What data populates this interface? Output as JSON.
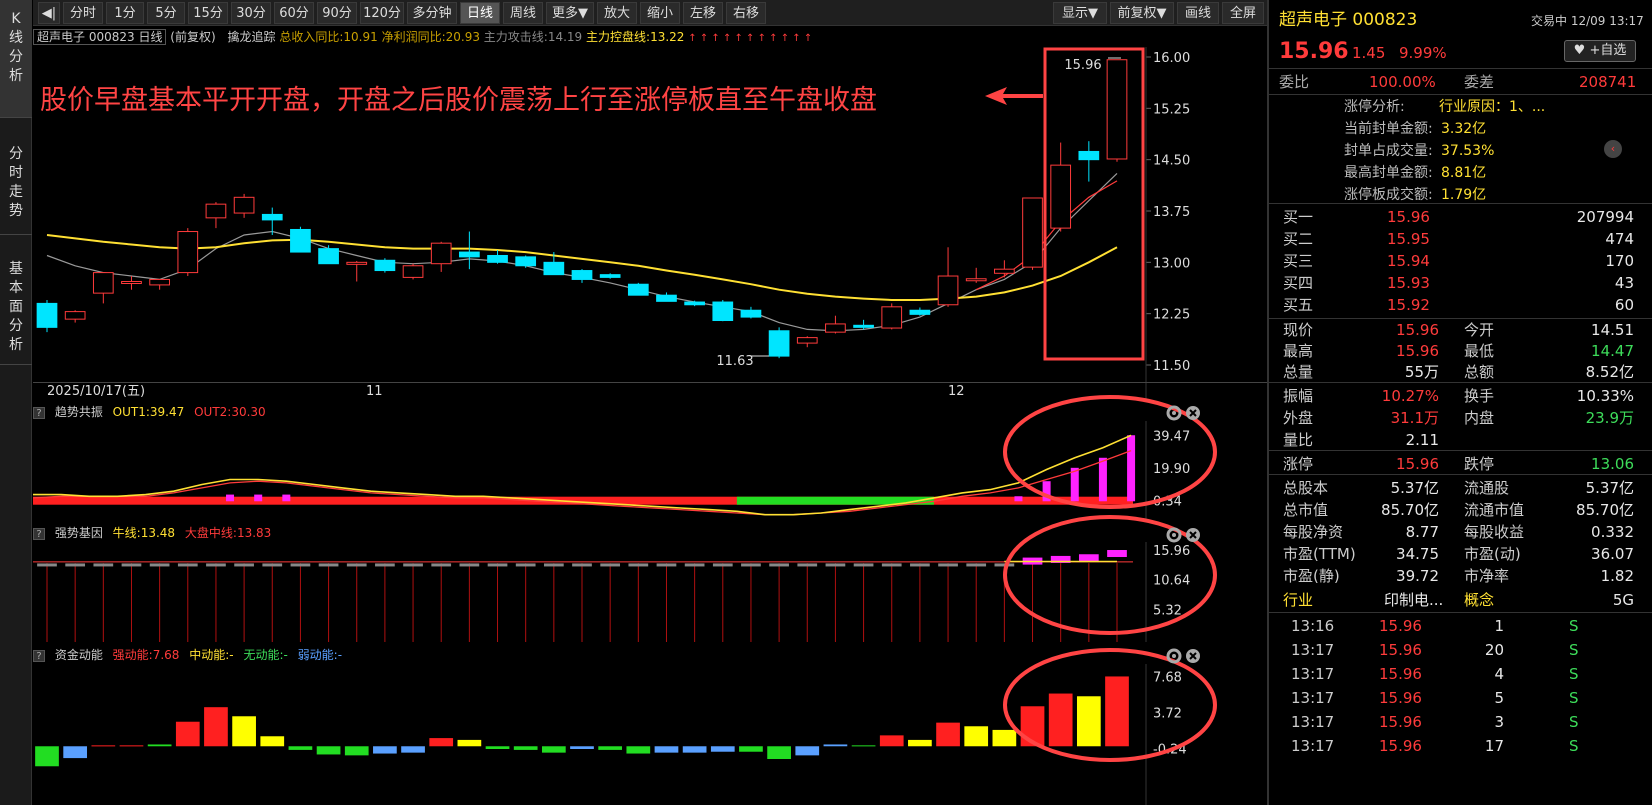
{
  "sidebar": {
    "tabs": [
      {
        "label": "K线分析",
        "chars": [
          "K",
          "线",
          "分",
          "析"
        ]
      },
      {
        "label": "分时走势",
        "chars": [
          "分",
          "时",
          "走",
          "势"
        ]
      },
      {
        "label": "基本面分析",
        "chars": [
          "基",
          "本",
          "面",
          "分",
          "析"
        ]
      }
    ]
  },
  "toolbar": {
    "back_label": "◀|",
    "periods": [
      "分时",
      "1分",
      "5分",
      "15分",
      "30分",
      "60分",
      "90分",
      "120分",
      "多分钟",
      "日线",
      "周线",
      "更多▼"
    ],
    "active_period": "日线",
    "tools": [
      "放大",
      "缩小",
      "左移",
      "右移"
    ],
    "right_tools": [
      "显示▼",
      "前复权▼",
      "画线",
      "全屏"
    ]
  },
  "titlebar": {
    "stock": "超声电子 000823 日线",
    "adj": "(前复权)",
    "indicator_name": "擒龙追踪",
    "income": "总收入同比:10.91",
    "profit": "净利润同比:20.93",
    "attack": "主力攻击线:14.19",
    "control": "主力控盘线:13.22",
    "marks": "↑ ↑ ↑ ↑ ↑ ↑ ↑ ↑ ↑ ↑ ↑"
  },
  "annotation": {
    "text": "股价早盘基本平开开盘，开盘之后股价震荡上行至涨停板直至午盘收盘",
    "color": "#ff4444"
  },
  "main_chart": {
    "y_ticks": [
      "16.00",
      "15.25",
      "14.50",
      "13.75",
      "13.00",
      "12.25",
      "11.50"
    ],
    "date_labels": [
      {
        "text": "2025/10/17(五)"
      },
      {
        "text": "11"
      },
      {
        "text": "12"
      }
    ],
    "high_label": "15.96",
    "low_label": "11.63",
    "colors": {
      "up": "#ff3b3b",
      "down": "#00e5ff",
      "ma_yellow": "#ffe033",
      "ma_gray": "#9a9a9a",
      "ma_red": "#ff3b3b",
      "highlight": "#ff4444"
    }
  },
  "chart_data": [
    {
      "type": "candlestick",
      "title": "超声电子 000823 日线",
      "ylim": [
        11.5,
        16.0
      ],
      "candles": [
        {
          "o": 12.4,
          "h": 12.45,
          "l": 11.98,
          "c": 12.05
        },
        {
          "o": 12.17,
          "h": 12.3,
          "l": 12.12,
          "c": 12.28
        },
        {
          "o": 12.55,
          "h": 12.85,
          "l": 12.4,
          "c": 12.85
        },
        {
          "o": 12.7,
          "h": 12.8,
          "l": 12.6,
          "c": 12.72
        },
        {
          "o": 12.67,
          "h": 12.75,
          "l": 12.6,
          "c": 12.75
        },
        {
          "o": 12.85,
          "h": 13.5,
          "l": 12.8,
          "c": 13.45
        },
        {
          "o": 13.65,
          "h": 13.88,
          "l": 13.5,
          "c": 13.85
        },
        {
          "o": 13.72,
          "h": 14.0,
          "l": 13.65,
          "c": 13.95
        },
        {
          "o": 13.7,
          "h": 13.8,
          "l": 13.4,
          "c": 13.62
        },
        {
          "o": 13.48,
          "h": 13.52,
          "l": 13.15,
          "c": 13.15
        },
        {
          "o": 13.2,
          "h": 13.25,
          "l": 12.98,
          "c": 12.98
        },
        {
          "o": 13.0,
          "h": 13.02,
          "l": 12.72,
          "c": 13.0
        },
        {
          "o": 13.03,
          "h": 13.06,
          "l": 12.85,
          "c": 12.88
        },
        {
          "o": 12.78,
          "h": 12.98,
          "l": 12.75,
          "c": 12.95
        },
        {
          "o": 12.98,
          "h": 13.3,
          "l": 12.86,
          "c": 13.28
        },
        {
          "o": 13.15,
          "h": 13.45,
          "l": 12.9,
          "c": 13.08
        },
        {
          "o": 13.1,
          "h": 13.18,
          "l": 12.98,
          "c": 13.0
        },
        {
          "o": 13.08,
          "h": 13.1,
          "l": 12.92,
          "c": 12.95
        },
        {
          "o": 13.0,
          "h": 13.15,
          "l": 12.82,
          "c": 12.82
        },
        {
          "o": 12.88,
          "h": 12.9,
          "l": 12.7,
          "c": 12.75
        },
        {
          "o": 12.82,
          "h": 12.84,
          "l": 12.76,
          "c": 12.78
        },
        {
          "o": 12.68,
          "h": 12.7,
          "l": 12.52,
          "c": 12.52
        },
        {
          "o": 12.52,
          "h": 12.56,
          "l": 12.43,
          "c": 12.43
        },
        {
          "o": 12.42,
          "h": 12.44,
          "l": 12.36,
          "c": 12.38
        },
        {
          "o": 12.42,
          "h": 12.45,
          "l": 12.14,
          "c": 12.15
        },
        {
          "o": 12.3,
          "h": 12.35,
          "l": 12.18,
          "c": 12.2
        },
        {
          "o": 12.0,
          "h": 12.05,
          "l": 11.6,
          "c": 11.63
        },
        {
          "o": 11.82,
          "h": 11.92,
          "l": 11.76,
          "c": 11.9
        },
        {
          "o": 11.98,
          "h": 12.22,
          "l": 11.96,
          "c": 12.1
        },
        {
          "o": 12.08,
          "h": 12.16,
          "l": 12.02,
          "c": 12.05
        },
        {
          "o": 12.04,
          "h": 12.4,
          "l": 12.02,
          "c": 12.35
        },
        {
          "o": 12.3,
          "h": 12.34,
          "l": 12.22,
          "c": 12.24
        },
        {
          "o": 12.38,
          "h": 13.22,
          "l": 12.35,
          "c": 12.8
        },
        {
          "o": 12.74,
          "h": 12.92,
          "l": 12.7,
          "c": 12.76
        },
        {
          "o": 12.84,
          "h": 13.03,
          "l": 12.78,
          "c": 12.9
        },
        {
          "o": 12.93,
          "h": 13.56,
          "l": 12.89,
          "c": 13.94
        },
        {
          "o": 13.5,
          "h": 14.75,
          "l": 13.45,
          "c": 14.42
        },
        {
          "o": 14.62,
          "h": 14.77,
          "l": 14.18,
          "c": 14.5
        },
        {
          "o": 14.51,
          "h": 15.96,
          "l": 14.47,
          "c": 15.96
        }
      ],
      "ma_yellow": [
        13.4,
        13.35,
        13.3,
        13.26,
        13.22,
        13.2,
        13.22,
        13.28,
        13.32,
        13.33,
        13.3,
        13.26,
        13.22,
        13.2,
        13.2,
        13.2,
        13.18,
        13.15,
        13.1,
        13.05,
        13.0,
        12.95,
        12.88,
        12.82,
        12.75,
        12.68,
        12.6,
        12.54,
        12.5,
        12.47,
        12.45,
        12.45,
        12.47,
        12.5,
        12.56,
        12.66,
        12.8,
        13.0,
        13.22
      ],
      "ma_gray": [
        13.1,
        12.95,
        12.85,
        12.8,
        12.75,
        12.9,
        13.2,
        13.4,
        13.45,
        13.35,
        13.2,
        13.1,
        13.0,
        12.98,
        13.0,
        13.05,
        13.02,
        12.95,
        12.85,
        12.78,
        12.7,
        12.6,
        12.5,
        12.42,
        12.35,
        12.28,
        12.12,
        12.02,
        12.0,
        12.02,
        12.08,
        12.2,
        12.4,
        12.6,
        12.75,
        13.0,
        13.5,
        13.9,
        14.3
      ],
      "ma_red": [
        null,
        null,
        null,
        null,
        null,
        null,
        null,
        null,
        null,
        null,
        null,
        null,
        null,
        null,
        null,
        null,
        null,
        null,
        null,
        null,
        null,
        null,
        null,
        null,
        null,
        null,
        null,
        null,
        null,
        null,
        null,
        null,
        null,
        12.6,
        12.8,
        13.1,
        13.6,
        13.95,
        14.19
      ]
    },
    {
      "type": "bar",
      "title": "趋势共振",
      "series_labels": {
        "out1": "OUT1:39.47",
        "out2": "OUT2:30.30"
      },
      "y_ticks": [
        "39.47",
        "19.90",
        "0.34"
      ],
      "ylim": [
        -10,
        45
      ],
      "out1": [
        4,
        4,
        3,
        3,
        4,
        6,
        10,
        13,
        13,
        12,
        10,
        8,
        6,
        5,
        4,
        3,
        3,
        2,
        1,
        0,
        -1,
        -2,
        -3,
        -4,
        -5,
        -6,
        -8,
        -8,
        -7,
        -5,
        -3,
        -1,
        2,
        5,
        7,
        11,
        19,
        26,
        32,
        39.47
      ],
      "out2": [
        2,
        3,
        3,
        3,
        3,
        5,
        8,
        11,
        12,
        11,
        9,
        7,
        5,
        4,
        3,
        2,
        2,
        1,
        0,
        -1,
        -2,
        -3,
        -4,
        -5,
        -6,
        -7,
        -8,
        -8,
        -7,
        -6,
        -4,
        -2,
        0,
        3,
        5,
        8,
        13,
        18,
        24,
        30.3
      ],
      "bars": [
        0,
        0,
        0,
        0,
        0,
        0,
        0,
        4,
        4,
        4,
        0,
        0,
        0,
        0,
        0,
        0,
        0,
        0,
        0,
        0,
        0,
        0,
        0,
        0,
        0,
        0,
        0,
        0,
        0,
        0,
        0,
        0,
        0,
        0,
        0,
        3,
        12,
        20,
        26,
        39.47
      ]
    },
    {
      "type": "bar",
      "title": "强势基因",
      "series_labels": {
        "bull": "牛线:13.48",
        "market": "大盘中线:13.83"
      },
      "y_ticks": [
        "15.96",
        "10.64",
        "5.32"
      ]
    },
    {
      "type": "bar",
      "title": "资金动能",
      "series_labels": {
        "strong": "强动能:7.68",
        "mid": "中动能:-",
        "none": "无动能:-",
        "weak": "弱动能:-"
      },
      "y_ticks": [
        "7.68",
        "3.72",
        "-0.24"
      ],
      "ylim": [
        -2.5,
        8.5
      ],
      "values": [
        -2.2,
        -1.3,
        0.1,
        0.1,
        0.2,
        2.7,
        4.3,
        3.3,
        1.1,
        -0.4,
        -0.9,
        -1.0,
        -0.8,
        -0.7,
        0.9,
        0.7,
        -0.3,
        -0.4,
        -0.7,
        -0.3,
        -0.4,
        -0.8,
        -0.7,
        -0.7,
        -0.6,
        -0.6,
        -1.4,
        -1.0,
        0.2,
        0.1,
        1.2,
        0.7,
        2.6,
        2.2,
        1.8,
        4.4,
        5.8,
        5.5,
        7.68
      ],
      "colors": [
        "g",
        "b",
        "r",
        "r",
        "g",
        "r",
        "r",
        "y",
        "y",
        "g",
        "g",
        "g",
        "b",
        "b",
        "r",
        "y",
        "g",
        "g",
        "g",
        "b",
        "g",
        "g",
        "b",
        "b",
        "b",
        "g",
        "g",
        "b",
        "b",
        "g",
        "r",
        "y",
        "r",
        "y",
        "y",
        "r",
        "r",
        "y",
        "r"
      ]
    }
  ],
  "right": {
    "title": "超声电子 000823",
    "status": "交易中 12/09 13:17",
    "price": "15.96",
    "change": "1.45",
    "pct": "9.99%",
    "fav_button": "♥ +自选",
    "weibi_label": "委比",
    "weibi": "100.00%",
    "weicha_label": "委差",
    "weicha": "208741",
    "limit_analysis": [
      {
        "label": "涨停分析:",
        "value": "行业原因：1、..."
      },
      {
        "label": "当前封单金额:",
        "value": "3.32亿"
      },
      {
        "label": "封单占成交量:",
        "value": "37.53%"
      },
      {
        "label": "最高封单金额:",
        "value": "8.81亿"
      },
      {
        "label": "涨停板成交额:",
        "value": "1.79亿"
      }
    ],
    "bids": [
      {
        "label": "买一",
        "price": "15.96",
        "vol": "207994"
      },
      {
        "label": "买二",
        "price": "15.95",
        "vol": "474"
      },
      {
        "label": "买三",
        "price": "15.94",
        "vol": "170"
      },
      {
        "label": "买四",
        "price": "15.93",
        "vol": "43"
      },
      {
        "label": "买五",
        "price": "15.92",
        "vol": "60"
      }
    ],
    "quote": [
      [
        {
          "k": "现价",
          "v": "15.96",
          "c": "red"
        },
        {
          "k": "今开",
          "v": "14.51",
          "c": "white"
        }
      ],
      [
        {
          "k": "最高",
          "v": "15.96",
          "c": "red"
        },
        {
          "k": "最低",
          "v": "14.47",
          "c": "green"
        }
      ],
      [
        {
          "k": "总量",
          "v": "55万",
          "c": "white"
        },
        {
          "k": "总额",
          "v": "8.52亿",
          "c": "white"
        }
      ]
    ],
    "quote2": [
      [
        {
          "k": "振幅",
          "v": "10.27%",
          "c": "red"
        },
        {
          "k": "换手",
          "v": "10.33%",
          "c": "white"
        }
      ],
      [
        {
          "k": "外盘",
          "v": "31.1万",
          "c": "red"
        },
        {
          "k": "内盘",
          "v": "23.9万",
          "c": "green"
        }
      ],
      [
        {
          "k": "量比",
          "v": "2.11",
          "c": "white"
        },
        {
          "k": "",
          "v": "",
          "c": "white"
        }
      ]
    ],
    "limit": [
      {
        "k": "涨停",
        "v": "15.96",
        "c": "red"
      },
      {
        "k": "跌停",
        "v": "13.06",
        "c": "green"
      }
    ],
    "fundamentals": [
      [
        {
          "k": "总股本",
          "v": "5.37亿"
        },
        {
          "k": "流通股",
          "v": "5.37亿"
        }
      ],
      [
        {
          "k": "总市值",
          "v": "85.70亿"
        },
        {
          "k": "流通市值",
          "v": "85.70亿"
        }
      ],
      [
        {
          "k": "每股净资",
          "v": "8.77"
        },
        {
          "k": "每股收益",
          "v": "0.332"
        }
      ],
      [
        {
          "k": "市盈(TTM)",
          "v": "34.75"
        },
        {
          "k": "市盈(动)",
          "v": "36.07"
        }
      ],
      [
        {
          "k": "市盈(静)",
          "v": "39.72"
        },
        {
          "k": "市净率",
          "v": "1.82"
        }
      ]
    ],
    "industry": {
      "k1": "行业",
      "v1": "印制电...",
      "k2": "概念",
      "v2": "5G"
    },
    "ticks": [
      {
        "t": "13:16",
        "p": "15.96",
        "v": "1",
        "s": "S"
      },
      {
        "t": "13:17",
        "p": "15.96",
        "v": "20",
        "s": "S"
      },
      {
        "t": "13:17",
        "p": "15.96",
        "v": "4",
        "s": "S"
      },
      {
        "t": "13:17",
        "p": "15.96",
        "v": "5",
        "s": "S"
      },
      {
        "t": "13:17",
        "p": "15.96",
        "v": "3",
        "s": "S"
      },
      {
        "t": "13:17",
        "p": "15.96",
        "v": "17",
        "s": "S"
      }
    ]
  }
}
